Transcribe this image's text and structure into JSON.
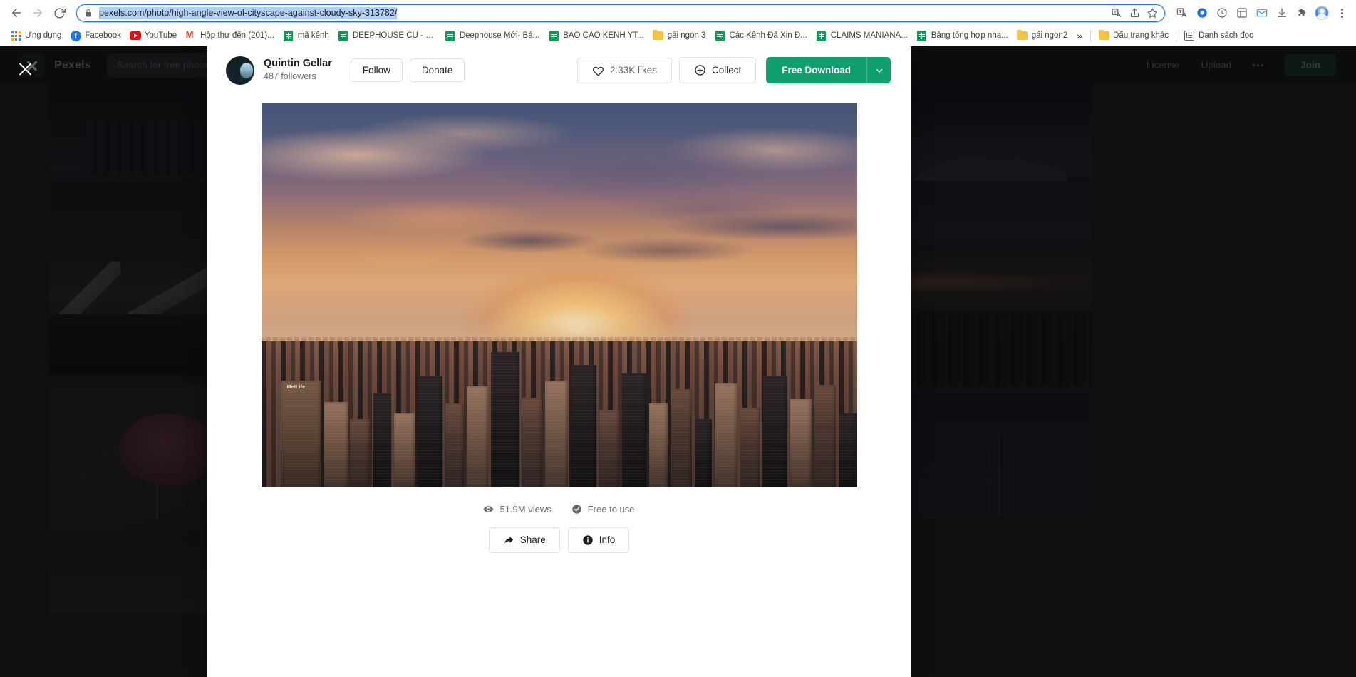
{
  "browser": {
    "url": "pexels.com/photo/high-angle-view-of-cityscape-against-cloudy-sky-313782/",
    "nav": {
      "back": "back-arrow",
      "forward": "forward-arrow",
      "reload": "reload"
    },
    "omnibox_icons": [
      "translate-icon",
      "share-icon",
      "bookmark-star-icon"
    ],
    "extension_icons": [
      "extension-puzzle-icon",
      "profile-avatar",
      "chrome-menu-icon"
    ],
    "bookmarks": [
      {
        "label": "Ứng dụng",
        "icon": "apps-grid-icon"
      },
      {
        "label": "Facebook",
        "icon": "facebook-icon"
      },
      {
        "label": "YouTube",
        "icon": "youtube-icon"
      },
      {
        "label": "Hộp thư đến (201)...",
        "icon": "gmail-icon"
      },
      {
        "label": "mã kênh",
        "icon": "google-sheets-icon"
      },
      {
        "label": "DEEPHOUSE CŨ - B...",
        "icon": "google-sheets-icon"
      },
      {
        "label": "Deephouse Mới- Bá...",
        "icon": "google-sheets-icon"
      },
      {
        "label": "BÁO CÁO KÊNH YT...",
        "icon": "google-sheets-icon"
      },
      {
        "label": "gái ngon 3",
        "icon": "folder-icon"
      },
      {
        "label": "Các Kênh Đã Xin Đ...",
        "icon": "google-sheets-icon"
      },
      {
        "label": "CLAIMS MANIANA...",
        "icon": "google-sheets-icon"
      },
      {
        "label": "Bảng tổng hợp nha...",
        "icon": "google-sheets-icon"
      },
      {
        "label": "gái ngon2",
        "icon": "folder-icon"
      }
    ],
    "bookmarks_overflow": "»",
    "bookmarks_right": [
      {
        "label": "Dấu trang khác",
        "icon": "folder-icon"
      },
      {
        "label": "Danh sách đọc",
        "icon": "reading-list-icon"
      }
    ]
  },
  "site": {
    "logo_text": "Pexels",
    "search_placeholder": "Search for free photos",
    "nav": [
      "License",
      "Upload"
    ],
    "more_label": "•••",
    "join_label": "Join",
    "close_label": "Close"
  },
  "modal": {
    "author": {
      "name": "Quintin Gellar",
      "followers": "487 followers",
      "avatar": "author-avatar"
    },
    "follow_label": "Follow",
    "donate_label": "Donate",
    "likes_label": "2.33K likes",
    "collect_label": "Collect",
    "download_label": "Free Download",
    "download_caret": "chevron-down-icon",
    "views_label": "51.9M views",
    "license_label": "Free to use",
    "share_label": "Share",
    "info_label": "Info",
    "photo": {
      "alt": "High angle view of cityscape against cloudy sky",
      "building_label": "MetLife"
    }
  },
  "colors": {
    "accent_green": "#0fa06e",
    "modal_bg": "#ffffff",
    "page_dark": "#1a1a1c",
    "header_dark": "#0f1114",
    "text_primary": "#1c1d21",
    "text_muted": "#6a6d72",
    "url_highlight": "#b2d0f7"
  }
}
